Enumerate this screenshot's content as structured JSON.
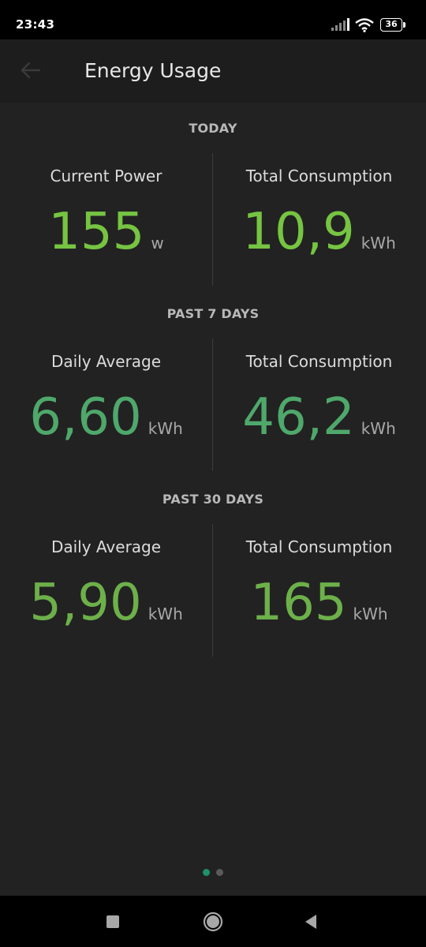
{
  "status_bar": {
    "time": "23:43",
    "battery": "36",
    "icons": [
      "signal-icon",
      "wifi-icon",
      "battery-icon"
    ]
  },
  "app_bar": {
    "title": "Energy Usage",
    "back_icon": "arrow-left-icon"
  },
  "colors": {
    "bright_green": "#76c442",
    "teal_green": "#4fa86b",
    "dot_active": "#1f8f6c",
    "dot_inactive": "#5a5a5a"
  },
  "sections": [
    {
      "header": "TODAY",
      "metrics": [
        {
          "label": "Current Power",
          "value": "155",
          "unit": "w",
          "color": "#76c442"
        },
        {
          "label": "Total Consumption",
          "value": "10,9",
          "unit": "kWh",
          "color": "#76c442"
        }
      ]
    },
    {
      "header": "PAST 7 DAYS",
      "metrics": [
        {
          "label": "Daily Average",
          "value": "6,60",
          "unit": "kWh",
          "color": "#4fa86b"
        },
        {
          "label": "Total Consumption",
          "value": "46,2",
          "unit": "kWh",
          "color": "#4fa86b"
        }
      ]
    },
    {
      "header": "PAST 30 DAYS",
      "metrics": [
        {
          "label": "Daily Average",
          "value": "5,90",
          "unit": "kWh",
          "color": "#6db04a"
        },
        {
          "label": "Total Consumption",
          "value": "165",
          "unit": "kWh",
          "color": "#6db04a"
        }
      ]
    }
  ],
  "pager": {
    "active_index": 0,
    "count": 2
  },
  "nav_bar": {
    "icons": [
      "recents-square-icon",
      "home-circle-icon",
      "back-triangle-icon"
    ]
  }
}
